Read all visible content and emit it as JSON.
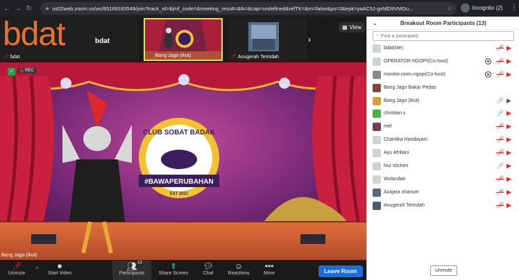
{
  "browser": {
    "url": "us02web.zoom.us/wc/85169183549/join?track_id=&jmf_code=&meeting_result=&tk=&cap=undefined&refTK=&rn=false&po=3&epk=yaAC5J-gxNlD9VMGu...",
    "profile_label": "Incognito (2)"
  },
  "strip": {
    "tile1_big": "bdat",
    "tile1_small": "bdat",
    "tile1_name": "bdat",
    "tile2_name": "Bang Jago (Ikut)",
    "tile3_name": "Anugerah Terindah",
    "view_label": "View"
  },
  "stage": {
    "rec_label": "REC",
    "speaker_name": "Bang Jago (Ikut)",
    "logo_title": "CLUB SOBAT BADAK",
    "logo_banner": "#BAWAPERUBAHAN",
    "logo_est": "EST 2021"
  },
  "toolbar": {
    "unmute": "Unmute",
    "start_video": "Start Video",
    "participants": "Participants",
    "participants_count": "13",
    "share_screen": "Share Screen",
    "chat": "Chat",
    "reactions": "Reactions",
    "more": "More",
    "leave": "Leave Room"
  },
  "panel": {
    "title": "Breakout Room Participants (13)",
    "search_placeholder": "Find a participant",
    "unmute_button": "Unmute",
    "participants": [
      {
        "name": "bdat(Me)",
        "avatar": "",
        "mic": "muted",
        "cam": "off",
        "recording": false,
        "avatar_color": "#cfd3d8"
      },
      {
        "name": "OPERATOR-NGOPI(Co-host)",
        "avatar": "",
        "mic": "muted",
        "cam": "off",
        "recording": true,
        "avatar_color": "#cfd3d8"
      },
      {
        "name": "monitor.room.ngopi(Co-host)",
        "avatar": "",
        "mic": "muted",
        "cam": "off",
        "recording": true,
        "avatar_color": "#8a8a8a"
      },
      {
        "name": "Bang Jago Bakar Pedas",
        "avatar": "",
        "mic": "none",
        "cam": "none",
        "recording": false,
        "avatar_color": "#7a4a3a"
      },
      {
        "name": "Bang Jago (Ikut)",
        "avatar": "",
        "mic": "on",
        "cam": "on",
        "recording": false,
        "avatar_color": "#d4a030"
      },
      {
        "name": "christian s",
        "avatar": "",
        "mic": "on",
        "cam": "off",
        "recording": false,
        "avatar_color": "#49b04a"
      },
      {
        "name": "mel",
        "avatar": "",
        "mic": "muted",
        "cam": "off",
        "recording": false,
        "avatar_color": "#7a3a5a"
      },
      {
        "name": "Chantika Handayani",
        "avatar": "",
        "mic": "muted",
        "cam": "off",
        "recording": false,
        "avatar_color": "#cfd3d8"
      },
      {
        "name": "Ayu Afriliani",
        "avatar": "",
        "mic": "muted",
        "cam": "off",
        "recording": false,
        "avatar_color": "#cfd3d8"
      },
      {
        "name": "Nur kitchen",
        "avatar": "",
        "mic": "on_gray",
        "cam": "off",
        "recording": false,
        "avatar_color": "#cfd3d8"
      },
      {
        "name": "Wulandari",
        "avatar": "",
        "mic": "muted",
        "cam": "off",
        "recording": false,
        "avatar_color": "#cfd3d8"
      },
      {
        "name": "Azajara shanum",
        "avatar": "",
        "mic": "muted",
        "cam": "off",
        "recording": false,
        "avatar_color": "#5a6a7a"
      },
      {
        "name": "Anugerah Terindah",
        "avatar": "",
        "mic": "muted",
        "cam": "off",
        "recording": false,
        "avatar_color": "#4a5a6a"
      }
    ]
  },
  "colors": {
    "accent_blue": "#1a6edb",
    "mute_red": "#e02828",
    "mic_green": "#49b04a",
    "bdat_orange": "#e8742b",
    "active_border": "#d8e842"
  }
}
